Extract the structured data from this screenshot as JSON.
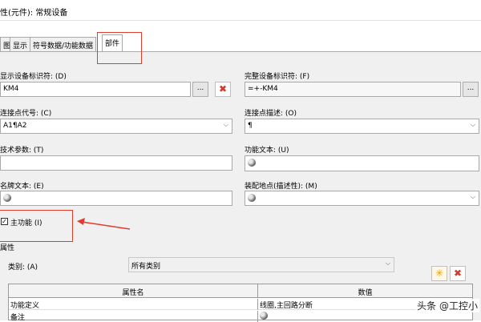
{
  "window": {
    "title": "性(元件): 常规设备"
  },
  "tabs": [
    "图",
    "显示",
    "符号数据/功能数据",
    "部件"
  ],
  "form": {
    "device_id_label": "显示设备标识符: (D)",
    "device_id_value": "KM4",
    "full_id_label": "完整设备标识符: (F)",
    "full_id_value": "=+-KM4",
    "conn_code_label": "连接点代号: (C)",
    "conn_code_value": "A1¶A2",
    "conn_desc_label": "连接点描述: (O)",
    "conn_desc_value": "¶",
    "tech_param_label": "技术参数: (T)",
    "tech_param_value": "",
    "func_text_label": "功能文本: (U)",
    "nameplate_label": "名牌文本: (E)",
    "mount_label": "装配地点(描述性): (M)",
    "main_function_label": "主功能 (I)",
    "main_function_checked": true
  },
  "properties": {
    "section_label": "属性",
    "category_label": "类别: (A)",
    "category_value": "所有类别",
    "columns": [
      "属性名",
      "数值"
    ],
    "rows": [
      {
        "name": "功能定义",
        "value": "线圈,主回路分断"
      },
      {
        "name": "备注",
        "value": ""
      }
    ]
  },
  "icons": {
    "ellipsis": "...",
    "delete": "✖",
    "new": "✳",
    "dropdown": "⌵"
  },
  "watermark": "头条 @工控小",
  "colors": {
    "highlight": "#e23c2d",
    "accent_delete": "#d23a2a"
  }
}
